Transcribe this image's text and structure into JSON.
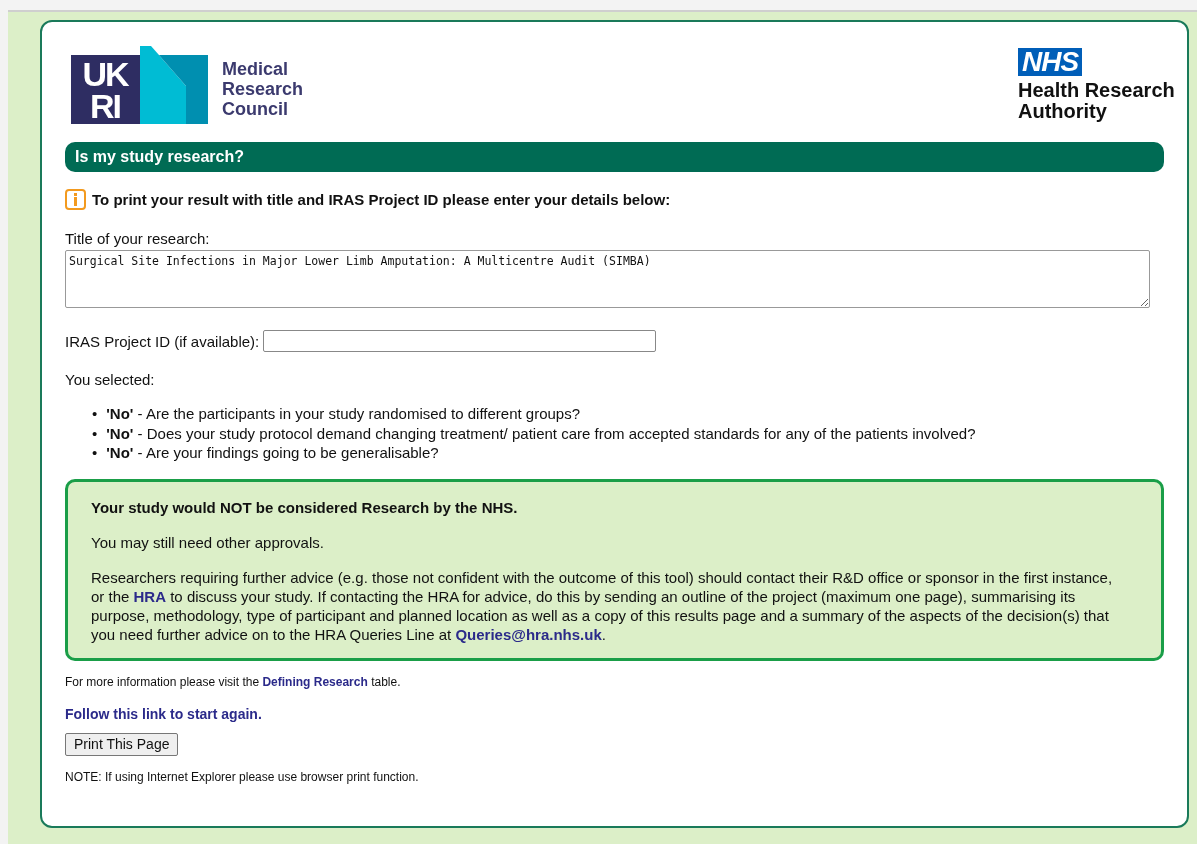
{
  "logos": {
    "funder": {
      "mark_lines": [
        "UK",
        "RI"
      ],
      "name_lines": [
        "Medical",
        "Research",
        "Council"
      ]
    },
    "authority": {
      "badge": "NHS",
      "name_lines": [
        "Health Research",
        "Authority"
      ]
    }
  },
  "header": {
    "title": "Is my study research?"
  },
  "details": {
    "notice": "To print your result with title and IRAS Project ID please enter your details below:",
    "title_field": {
      "label": "Title of your research:",
      "value": "Surgical Site Infections in Major Lower Limb Amputation: A Multicentre Audit (SIMBA)"
    },
    "iras_field": {
      "label": "IRAS Project ID (if available):"
    }
  },
  "answers": {
    "heading": "You selected:",
    "items": [
      {
        "marker": "•",
        "answer": "'No'",
        "question": "- Are the participants in your study randomised to different groups?"
      },
      {
        "marker": "•",
        "answer": "'No'",
        "question": "- Does your study protocol demand changing treatment/ patient care from accepted standards for any of the patients involved?"
      },
      {
        "marker": "•",
        "answer": "'No'",
        "question": "- Are your findings going to be generalisable?"
      }
    ]
  },
  "result": {
    "verdict": "Your study would NOT be considered Research by the NHS.",
    "note": "You may still need other approvals.",
    "advice": [
      {
        "kind": "text",
        "text": "Researchers requiring further advice (e.g. those not confident with the outcome of this tool) should contact their R&D office or sponsor in the first instance, or the "
      },
      {
        "kind": "link",
        "text": "HRA"
      },
      {
        "kind": "text",
        "text": " to discuss your study. If contacting the HRA for advice, do this by sending an outline of the project (maximum one page), summarising its purpose, methodology, type of participant and planned location as well as a copy of this results page and a summary of the aspects of the decision(s) that you need further advice on to the HRA Queries Line at "
      },
      {
        "kind": "link",
        "text": "Queries@hra.nhs.uk"
      },
      {
        "kind": "text",
        "text": "."
      }
    ]
  },
  "footer": {
    "more_info": [
      {
        "kind": "text",
        "text": "For more information please visit the "
      },
      {
        "kind": "link",
        "text": "Defining Research"
      },
      {
        "kind": "text",
        "text": " table."
      }
    ],
    "restart_link": "Follow this link to start again.",
    "print_button": "Print This Page",
    "note": "NOTE: If using Internet Explorer please use browser print function."
  }
}
